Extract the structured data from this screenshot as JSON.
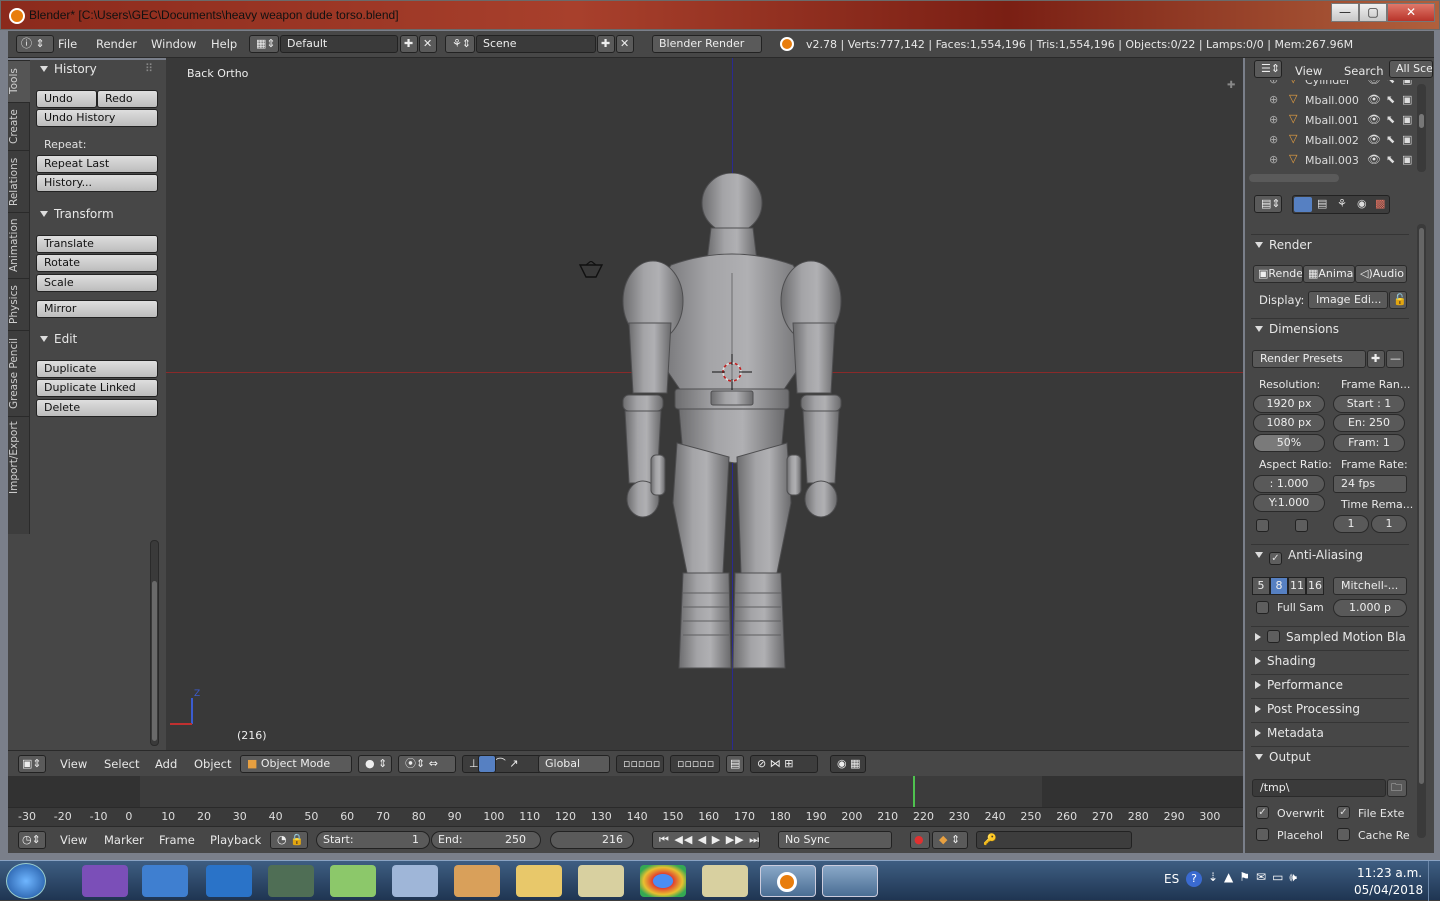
{
  "window": {
    "title": "Blender* [C:\\Users\\GEC\\Documents\\heavy weapon dude torso.blend]",
    "minimize": "—",
    "maximize": "▢",
    "close": "✕"
  },
  "info_header": {
    "menus": [
      "File",
      "Render",
      "Window",
      "Help"
    ],
    "screen_layout": "Default",
    "scene": "Scene",
    "render_engine": "Blender Render",
    "stats": "v2.78 | Verts:777,142 | Faces:1,554,196 | Tris:1,554,196 | Objects:0/22 | Lamps:0/0 | Mem:267.96M"
  },
  "tool_tabs": [
    "Tools",
    "Create",
    "Relations",
    "Animation",
    "Physics",
    "Grease Pencil",
    "Import/Export"
  ],
  "toolshelf": {
    "history": {
      "title": "History",
      "undo": "Undo",
      "redo": "Redo",
      "undo_history": "Undo History",
      "repeat_label": "Repeat:",
      "repeat_last": "Repeat Last",
      "history": "History..."
    },
    "transform": {
      "title": "Transform",
      "translate": "Translate",
      "rotate": "Rotate",
      "scale": "Scale",
      "mirror": "Mirror"
    },
    "edit": {
      "title": "Edit",
      "duplicate": "Duplicate",
      "duplicate_linked": "Duplicate Linked",
      "delete": "Delete"
    }
  },
  "viewport": {
    "view_name": "Back Ortho",
    "frame_label": "(216)",
    "axis_z": "Z"
  },
  "view3d_header": {
    "menus": [
      "View",
      "Select",
      "Add",
      "Object"
    ],
    "mode": "Object Mode",
    "orientation": "Global"
  },
  "timeline": {
    "ruler": [
      "-30",
      "-20",
      "-10",
      "0",
      "10",
      "20",
      "30",
      "40",
      "50",
      "60",
      "70",
      "80",
      "90",
      "100",
      "110",
      "120",
      "130",
      "140",
      "150",
      "160",
      "170",
      "180",
      "190",
      "200",
      "210",
      "220",
      "230",
      "240",
      "250",
      "260",
      "270",
      "280",
      "290",
      "300"
    ],
    "menus": [
      "View",
      "Marker",
      "Frame",
      "Playback"
    ],
    "start_label": "Start:",
    "start": "1",
    "end_label": "End:",
    "end": "250",
    "current": "216",
    "sync": "No Sync",
    "current_frame_value": 216
  },
  "outliner": {
    "menus": [
      "View",
      "Search"
    ],
    "filter": "All Scen",
    "items": [
      "Cylinder",
      "Mball.000",
      "Mball.001",
      "Mball.002",
      "Mball.003"
    ]
  },
  "properties": {
    "render": {
      "title": "Render",
      "render_btn": "Rende",
      "anim_btn": "Anima",
      "audio_btn": "Audio",
      "display_label": "Display:",
      "display_value": "Image Edi..."
    },
    "dimensions": {
      "title": "Dimensions",
      "presets": "Render Presets",
      "resolution_label": "Resolution:",
      "res_x": "1920 px",
      "res_y": "1080 px",
      "res_pct": "50%",
      "frame_range_label": "Frame Ran...",
      "start": "Start : 1",
      "end": "En:  250",
      "frame": "Fram:  1",
      "aspect_label": "Aspect Ratio:",
      "aspect_x": ":  1.000",
      "aspect_y": "Y:1.000",
      "frame_rate_label": "Frame Rate:",
      "fps": "24 fps",
      "time_remap_label": "Time Rema...",
      "remap_old": "1",
      "remap_new": "1"
    },
    "anti_aliasing": {
      "title": "Anti-Aliasing",
      "samples": [
        "5",
        "8",
        "11",
        "16"
      ],
      "selected_sample": "8",
      "filter": "Mitchell-...",
      "full_sample": "Full Sam",
      "size": "1.000 p"
    },
    "collapsed": [
      "Sampled Motion Blur",
      "Shading",
      "Performance",
      "Post Processing",
      "Metadata"
    ],
    "sampled_motion_blur_display": "Sampled Motion Bla",
    "output": {
      "title": "Output",
      "path": "/tmp\\",
      "overwrite": "Overwrit",
      "file_ext": "File Exte",
      "placeholders": "Placehol",
      "cache": "Cache Re"
    }
  },
  "taskbar": {
    "lang": "ES",
    "time": "11:23 a.m.",
    "date": "05/04/2018"
  },
  "colors": {
    "accent": "#e87d0d",
    "selected": "#5680c2",
    "viewport_bg": "#393939",
    "x_axis": "#8a2a2a",
    "z_axis": "#2a2a90",
    "frame_marker": "#4fc24f"
  }
}
